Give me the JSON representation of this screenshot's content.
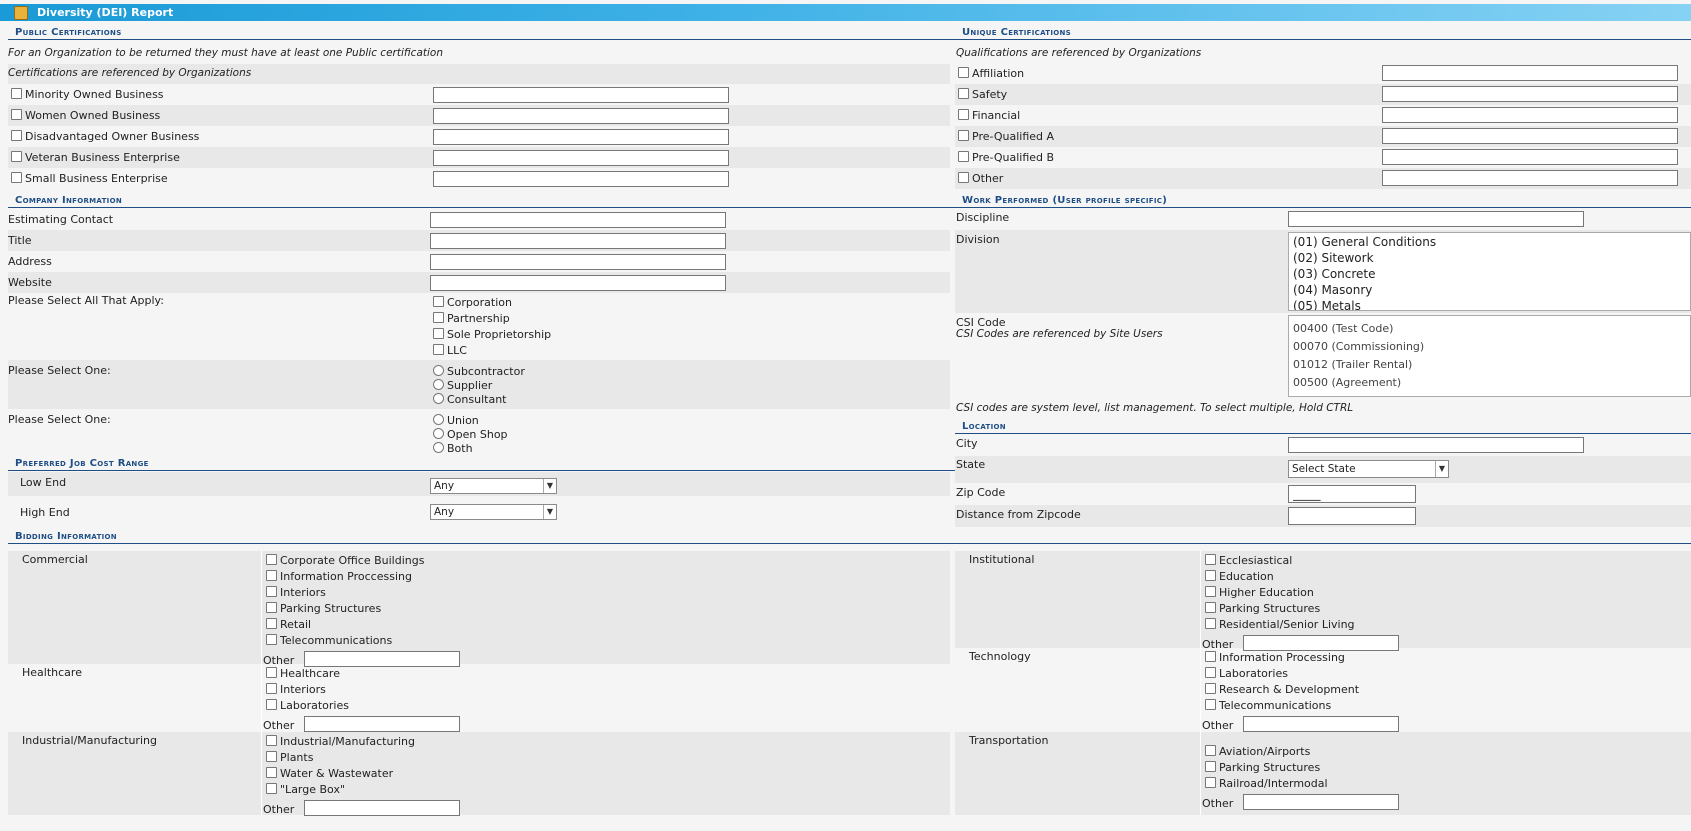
{
  "window": {
    "title": "Diversity (DEI) Report",
    "icon": "report-icon"
  },
  "public_certs": {
    "header": "Public Certifications",
    "note1": "For an Organization to be returned they must have at least one Public certification",
    "note2": "Certifications are referenced by Organizations",
    "items": [
      {
        "label": "Minority Owned Business",
        "value": ""
      },
      {
        "label": "Women Owned Business",
        "value": ""
      },
      {
        "label": "Disadvantaged Owner Business",
        "value": ""
      },
      {
        "label": "Veteran Business Enterprise",
        "value": ""
      },
      {
        "label": "Small Business Enterprise",
        "value": ""
      }
    ]
  },
  "unique_certs": {
    "header": "Unique Certifications",
    "note": "Qualifications are referenced by Organizations",
    "items": [
      {
        "label": "Affiliation",
        "value": ""
      },
      {
        "label": "Safety",
        "value": ""
      },
      {
        "label": "Financial",
        "value": ""
      },
      {
        "label": "Pre-Qualified A",
        "value": ""
      },
      {
        "label": "Pre-Qualified B",
        "value": ""
      },
      {
        "label": "Other",
        "value": ""
      }
    ]
  },
  "company": {
    "header": "Company Information",
    "fields": [
      {
        "label": "Estimating Contact",
        "value": ""
      },
      {
        "label": "Title",
        "value": ""
      },
      {
        "label": "Address",
        "value": ""
      },
      {
        "label": "Website",
        "value": ""
      }
    ],
    "select_all_label": "Please Select All That Apply:",
    "entity_types": [
      "Corporation",
      "Partnership",
      "Sole Proprietorship",
      "LLC"
    ],
    "select_one_label_1": "Please Select One:",
    "roles": [
      "Subcontractor",
      "Supplier",
      "Consultant"
    ],
    "select_one_label_2": "Please Select One:",
    "labor": [
      "Union",
      "Open Shop",
      "Both"
    ]
  },
  "work": {
    "header": "Work Performed (User profile specific)",
    "discipline_label": "Discipline",
    "discipline_value": "",
    "division_label": "Division",
    "divisions": [
      "(01) General Conditions",
      "(02) Sitework",
      "(03) Concrete",
      "(04) Masonry",
      "(05) Metals"
    ],
    "csi_label": "CSI Code",
    "csi_note": "CSI Codes are referenced by Site Users",
    "csi_codes": [
      "00400 (Test Code)",
      "00070 (Commissioning)",
      "01012 (Trailer Rental)",
      "00500 (Agreement)"
    ],
    "csi_footer": "CSI codes are system level, list management. To select multiple, Hold CTRL"
  },
  "location": {
    "header": "Location",
    "city_label": "City",
    "city_value": "",
    "state_label": "State",
    "state_value": "Select State",
    "zip_label": "Zip Code",
    "zip_value": "_____",
    "distance_label": "Distance from Zipcode",
    "distance_value": ""
  },
  "job_cost": {
    "header": "Preferred Job Cost Range",
    "low_label": "Low End",
    "low_value": "Any",
    "high_label": "High End",
    "high_value": "Any"
  },
  "bidding": {
    "header": "Bidding Information",
    "other_label": "Other",
    "groups_left": [
      {
        "name": "Commercial",
        "items": [
          "Corporate Office Buildings",
          "Information Proccessing",
          "Interiors",
          "Parking Structures",
          "Retail",
          "Telecommunications"
        ]
      },
      {
        "name": "Healthcare",
        "items": [
          "Healthcare",
          "Interiors",
          "Laboratories"
        ]
      },
      {
        "name": "Industrial/Manufacturing",
        "items": [
          "Industrial/Manufacturing",
          "Plants",
          "Water & Wastewater",
          "\"Large Box\""
        ]
      }
    ],
    "groups_right": [
      {
        "name": "Institutional",
        "items": [
          "Ecclesiastical",
          "Education",
          "Higher Education",
          "Parking Structures",
          "Residential/Senior Living"
        ]
      },
      {
        "name": "Technology",
        "items": [
          "Information Processing",
          "Laboratories",
          "Research & Development",
          "Telecommunications"
        ]
      },
      {
        "name": "Transportation",
        "items": [
          "Aviation/Airports",
          "Parking Structures",
          "Railroad/Intermodal"
        ]
      }
    ]
  }
}
